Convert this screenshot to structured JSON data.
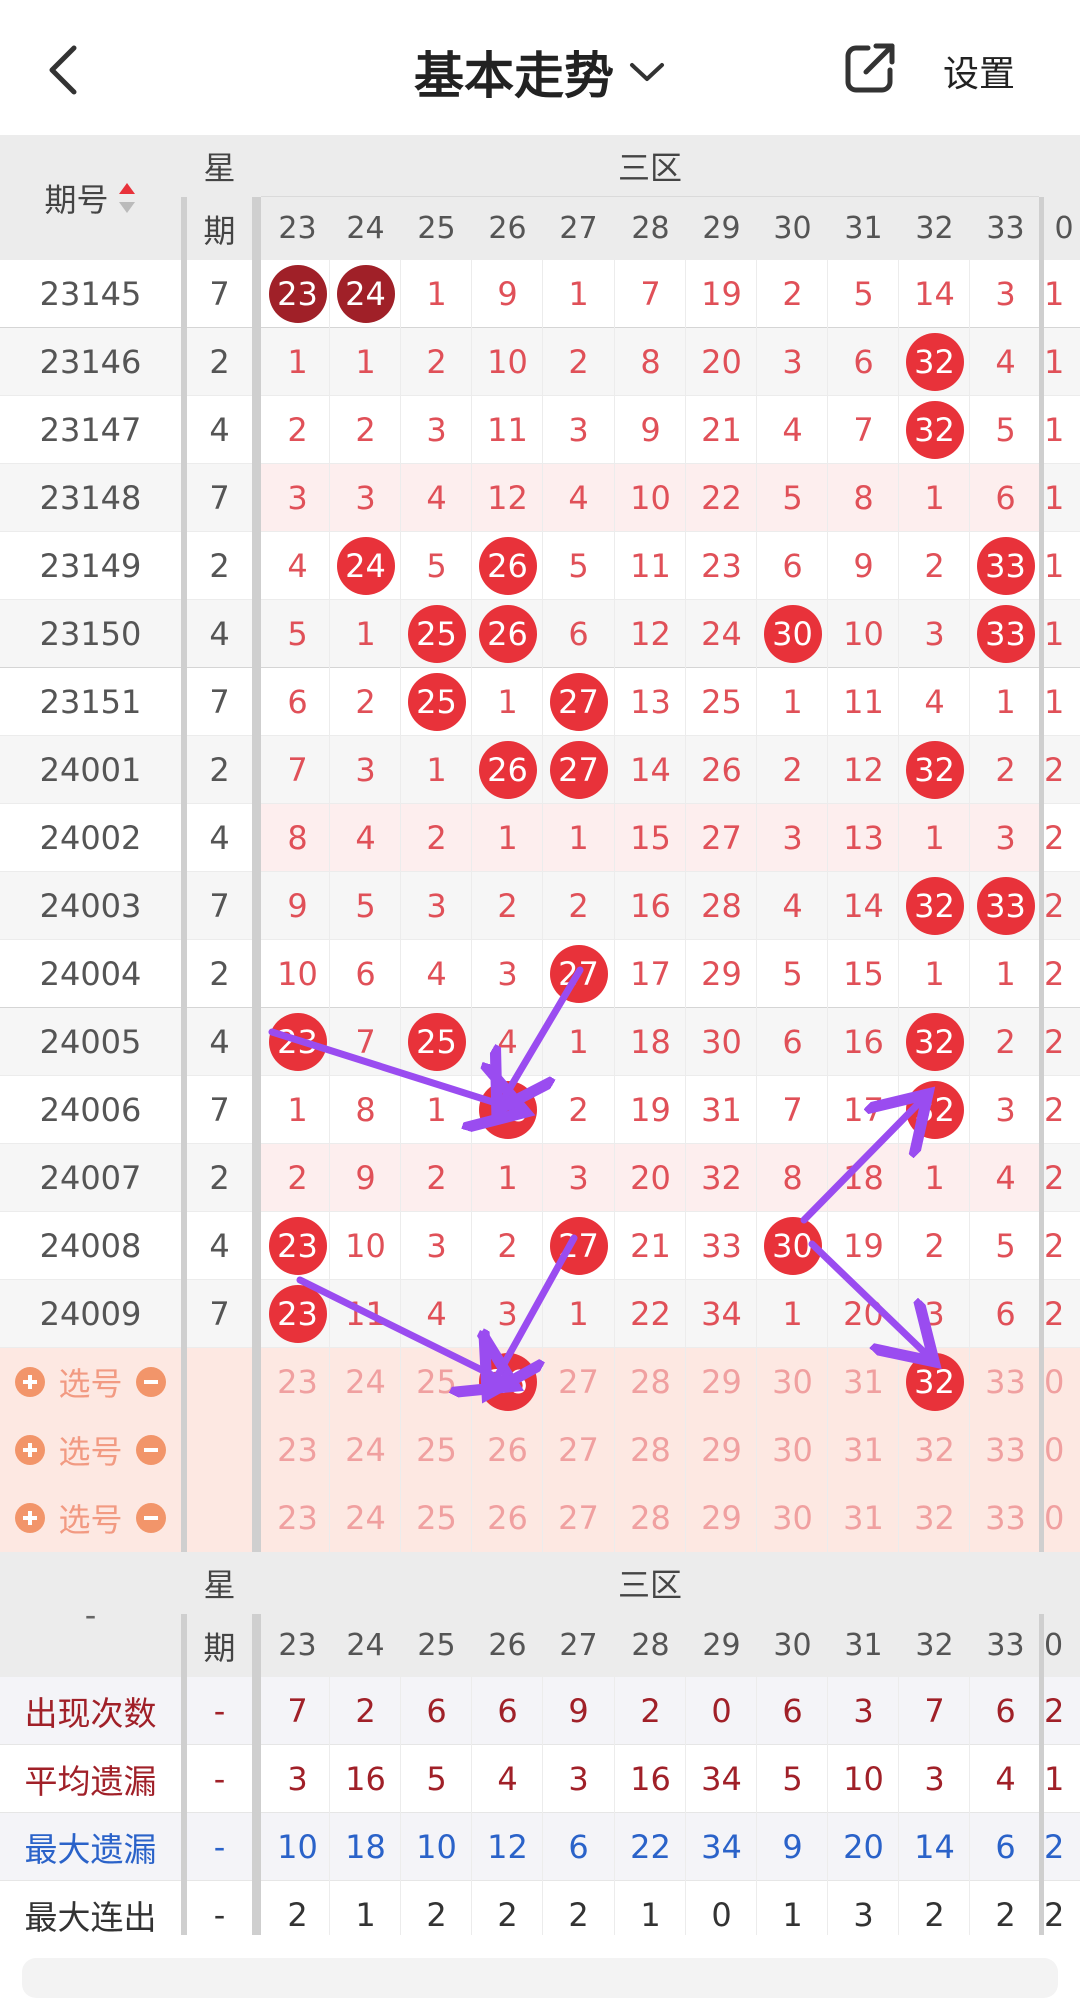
{
  "header": {
    "title": "基本走势",
    "settings_label": "设置"
  },
  "table": {
    "issue_header": "期号",
    "week_header": "星期",
    "zone_label": "三区",
    "columns": [
      "23",
      "24",
      "25",
      "26",
      "27",
      "28",
      "29",
      "30",
      "31",
      "32",
      "33",
      "0"
    ],
    "rows": [
      {
        "issue": "23145",
        "week": "7",
        "cells": [
          "23",
          "24",
          "1",
          "9",
          "1",
          "7",
          "19",
          "2",
          "5",
          "14",
          "3",
          "1"
        ],
        "hits": [
          0,
          1
        ],
        "dark": [
          0,
          1
        ]
      },
      {
        "issue": "23146",
        "week": "2",
        "cells": [
          "1",
          "1",
          "2",
          "10",
          "2",
          "8",
          "20",
          "3",
          "6",
          "32",
          "4",
          "1"
        ],
        "hits": [
          9
        ]
      },
      {
        "issue": "23147",
        "week": "4",
        "cells": [
          "2",
          "2",
          "3",
          "11",
          "3",
          "9",
          "21",
          "4",
          "7",
          "32",
          "5",
          "1"
        ],
        "hits": [
          9
        ]
      },
      {
        "issue": "23148",
        "week": "7",
        "cells": [
          "3",
          "3",
          "4",
          "12",
          "4",
          "10",
          "22",
          "5",
          "8",
          "1",
          "6",
          "1"
        ],
        "hits": []
      },
      {
        "issue": "23149",
        "week": "2",
        "cells": [
          "4",
          "24",
          "5",
          "26",
          "5",
          "11",
          "23",
          "6",
          "9",
          "2",
          "33",
          "1"
        ],
        "hits": [
          1,
          3,
          10
        ]
      },
      {
        "issue": "23150",
        "week": "4",
        "cells": [
          "5",
          "1",
          "25",
          "26",
          "6",
          "12",
          "24",
          "30",
          "10",
          "3",
          "33",
          "1"
        ],
        "hits": [
          2,
          3,
          7,
          10
        ]
      },
      {
        "issue": "23151",
        "week": "7",
        "cells": [
          "6",
          "2",
          "25",
          "1",
          "27",
          "13",
          "25",
          "1",
          "11",
          "4",
          "1",
          "1"
        ],
        "hits": [
          2,
          4
        ]
      },
      {
        "issue": "24001",
        "week": "2",
        "cells": [
          "7",
          "3",
          "1",
          "26",
          "27",
          "14",
          "26",
          "2",
          "12",
          "32",
          "2",
          "2"
        ],
        "hits": [
          3,
          4,
          9
        ]
      },
      {
        "issue": "24002",
        "week": "4",
        "cells": [
          "8",
          "4",
          "2",
          "1",
          "1",
          "15",
          "27",
          "3",
          "13",
          "1",
          "3",
          "2"
        ],
        "hits": []
      },
      {
        "issue": "24003",
        "week": "7",
        "cells": [
          "9",
          "5",
          "3",
          "2",
          "2",
          "16",
          "28",
          "4",
          "14",
          "32",
          "33",
          "2"
        ],
        "hits": [
          9,
          10
        ]
      },
      {
        "issue": "24004",
        "week": "2",
        "cells": [
          "10",
          "6",
          "4",
          "3",
          "27",
          "17",
          "29",
          "5",
          "15",
          "1",
          "1",
          "2"
        ],
        "hits": [
          4
        ]
      },
      {
        "issue": "24005",
        "week": "4",
        "cells": [
          "23",
          "7",
          "25",
          "4",
          "1",
          "18",
          "30",
          "6",
          "16",
          "32",
          "2",
          "2"
        ],
        "hits": [
          0,
          2,
          9
        ]
      },
      {
        "issue": "24006",
        "week": "7",
        "cells": [
          "1",
          "8",
          "1",
          "26",
          "2",
          "19",
          "31",
          "7",
          "17",
          "32",
          "3",
          "2"
        ],
        "hits": [
          3,
          9
        ]
      },
      {
        "issue": "24007",
        "week": "2",
        "cells": [
          "2",
          "9",
          "2",
          "1",
          "3",
          "20",
          "32",
          "8",
          "18",
          "1",
          "4",
          "2"
        ],
        "hits": []
      },
      {
        "issue": "24008",
        "week": "4",
        "cells": [
          "23",
          "10",
          "3",
          "2",
          "27",
          "21",
          "33",
          "30",
          "19",
          "2",
          "5",
          "2"
        ],
        "hits": [
          0,
          4,
          7
        ]
      },
      {
        "issue": "24009",
        "week": "7",
        "cells": [
          "23",
          "11",
          "4",
          "3",
          "1",
          "22",
          "34",
          "1",
          "20",
          "3",
          "6",
          "2"
        ],
        "hits": [
          0
        ]
      }
    ],
    "select_label": "选号",
    "select_rows": [
      {
        "hits": [
          3,
          9
        ]
      },
      {
        "hits": []
      },
      {
        "hits": []
      }
    ],
    "select_values": [
      "23",
      "24",
      "25",
      "26",
      "27",
      "28",
      "29",
      "30",
      "31",
      "32",
      "33",
      "0"
    ],
    "select_ball_values": [
      "26",
      "32"
    ],
    "stats_dash": "-",
    "stats": [
      {
        "label": "出现次数",
        "dash": "-",
        "values": [
          "7",
          "2",
          "6",
          "6",
          "9",
          "2",
          "0",
          "6",
          "3",
          "7",
          "6",
          "2"
        ],
        "color": "#a02028"
      },
      {
        "label": "平均遗漏",
        "dash": "-",
        "values": [
          "3",
          "16",
          "5",
          "4",
          "3",
          "16",
          "34",
          "5",
          "10",
          "3",
          "4",
          "1"
        ],
        "color": "#a02028"
      },
      {
        "label": "最大遗漏",
        "dash": "-",
        "values": [
          "10",
          "18",
          "10",
          "12",
          "6",
          "22",
          "34",
          "9",
          "20",
          "14",
          "6",
          "2"
        ],
        "color": "#2a62c9"
      },
      {
        "label": "最大连出",
        "dash": "-",
        "values": [
          "2",
          "1",
          "2",
          "2",
          "2",
          "1",
          "0",
          "1",
          "3",
          "2",
          "2",
          "2"
        ],
        "color": "#333"
      }
    ]
  },
  "colors": {
    "hit_ball": "#e8323a",
    "hit_ball_dark": "#a02028",
    "cell_text": "#e05058",
    "select_text": "#f0a0a0",
    "arrow": "#9a4cf0",
    "header_bg": "#ececec",
    "alt_row_bg": "#fdeeee",
    "select_bg": "#fde8e2"
  },
  "icons": [
    "back-arrow-icon",
    "chevron-down-icon",
    "share-icon",
    "sort-icon",
    "plus-icon",
    "minus-icon"
  ]
}
